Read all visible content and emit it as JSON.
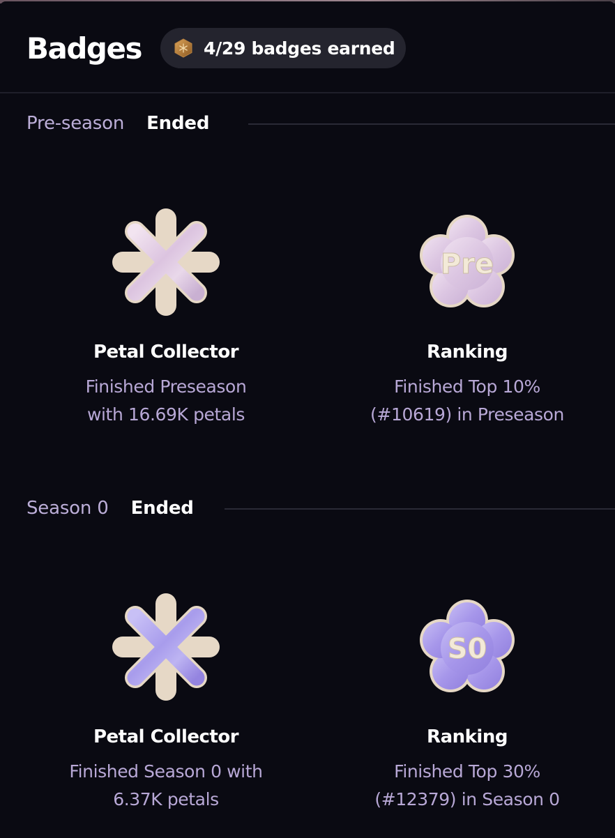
{
  "header": {
    "title": "Badges",
    "earned_label": "4/29 badges earned",
    "earned_icon": "hexagon-badge-icon"
  },
  "sections": [
    {
      "name": "Pre-season",
      "status": "Ended",
      "badges": [
        {
          "title": "Petal Collector",
          "desc_line1": "Finished Preseason",
          "desc_line2": "with 16.69K petals",
          "icon": "asterisk-badge-icon"
        },
        {
          "title": "Ranking",
          "desc_line1": "Finished Top 10%",
          "desc_line2": "(#10619) in Preseason",
          "icon": "flower-badge-icon",
          "badge_text": "Pre"
        }
      ]
    },
    {
      "name": "Season 0",
      "status": "Ended",
      "badges": [
        {
          "title": "Petal Collector",
          "desc_line1": "Finished Season 0 with",
          "desc_line2": "6.37K petals",
          "icon": "asterisk-badge-icon"
        },
        {
          "title": "Ranking",
          "desc_line1": "Finished Top 30%",
          "desc_line2": "(#12379) in Season 0",
          "icon": "flower-badge-icon",
          "badge_text": "S0"
        }
      ]
    }
  ],
  "colors": {
    "background": "#0a0a12",
    "pill_bg": "#24242e",
    "section_name": "#bcaed8",
    "description": "#b8a8d6",
    "preseason_badge": "#e2cde4",
    "season0_badge": "#aea4ee",
    "badge_rim": "#e8dccc"
  }
}
